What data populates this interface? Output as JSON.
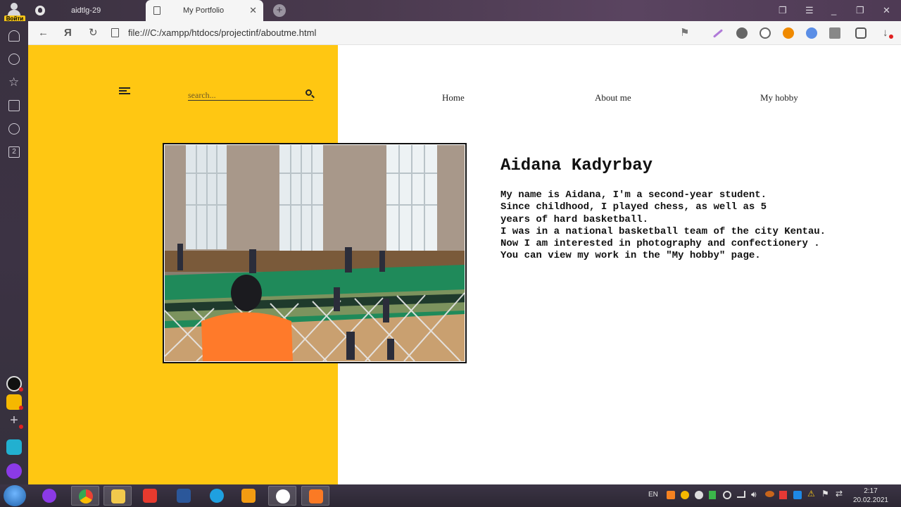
{
  "browser": {
    "profile_login": "Войти",
    "tabs": [
      {
        "title": "aidtlg-29"
      },
      {
        "title": "My Portfolio"
      }
    ],
    "url": "file:///C:/xampp/htdocs/projectinf/aboutme.html",
    "sidebar_badge": "2"
  },
  "page": {
    "search": {
      "placeholder": "search..."
    },
    "nav": [
      {
        "label": "Home"
      },
      {
        "label": "About me"
      },
      {
        "label": "My hobby"
      }
    ],
    "bio": {
      "name": "Aidana Kadyrbay",
      "lines": [
        "My name is Aidana, I'm a second-year student.",
        "Since childhood, I played chess, as well as 5",
        "years of hard basketball.",
        "I was in a national basketball team of the city Kentau.",
        "Now I am interested in photography and confectionery .",
        "You can view my work in the \"My hobby\" page."
      ]
    },
    "colors": {
      "accent": "#ffc712",
      "background": "#ffffff",
      "text": "#111111"
    }
  },
  "taskbar": {
    "language": "EN",
    "time": "2:17",
    "date": "20.02.2021"
  }
}
